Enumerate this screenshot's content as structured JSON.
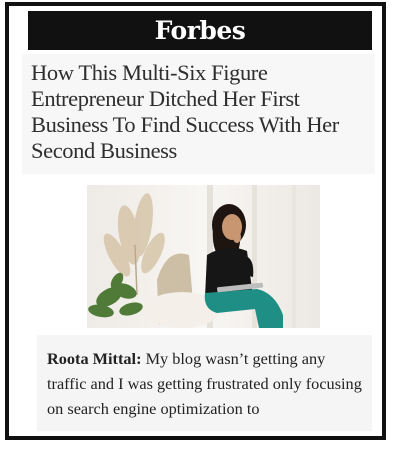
{
  "masthead": {
    "logo_text": "Forbes"
  },
  "article": {
    "headline": "How This Multi-Six Figure Entrepreneur Ditched Her First Business To Find Success With Her Second Business",
    "photo": {
      "icon": "photo-woman-with-laptop"
    },
    "quote": {
      "speaker": "Roota Mittal:",
      "text": "My blog wasn’t getting any traffic and I was getting frustrated only focusing on search engine optimization to"
    }
  },
  "colors": {
    "frame": "#111111",
    "masthead_bg": "#111111",
    "masthead_text": "#ffffff",
    "teal_pants": "#1f8f86"
  }
}
